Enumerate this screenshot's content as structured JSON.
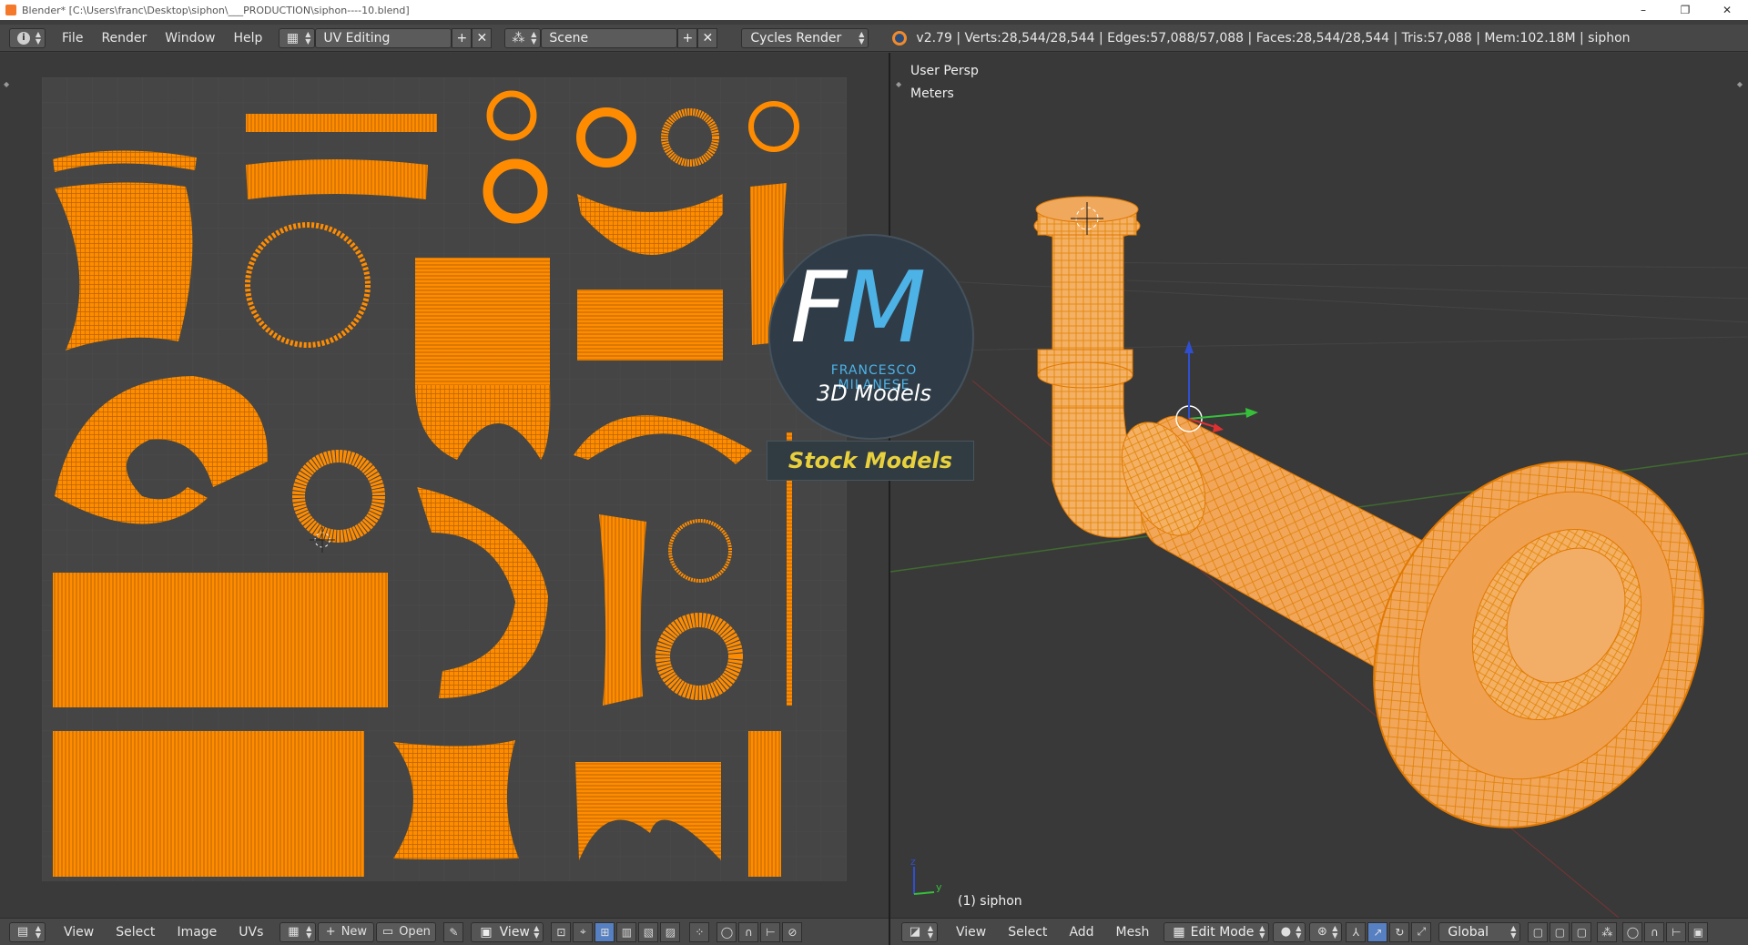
{
  "window": {
    "title": "Blender* [C:\\Users\\franc\\Desktop\\siphon\\___PRODUCTION\\siphon----10.blend]",
    "controls": [
      "–",
      "❐",
      "✕"
    ]
  },
  "info_header": {
    "menus": [
      "File",
      "Render",
      "Window",
      "Help"
    ],
    "screen_layout": "UV Editing",
    "scene": "Scene",
    "render_engine": "Cycles Render",
    "stats": "v2.79 | Verts:28,544/28,544 | Edges:57,088/57,088 | Faces:28,544/28,544 | Tris:57,088 | Mem:102.18M | siphon"
  },
  "uv_editor": {
    "menus": [
      "View",
      "Select",
      "Image",
      "UVs"
    ],
    "new_label": "New",
    "open_label": "Open",
    "view_label": "View",
    "uv_color": "#ff8c00",
    "grid_color": "#434343"
  },
  "viewport": {
    "view_name": "User Persp",
    "units": "Meters",
    "object_label": "(1) siphon",
    "menus": [
      "View",
      "Select",
      "Add",
      "Mesh"
    ],
    "mode": "Edit Mode",
    "orientation": "Global",
    "axis_z": "z",
    "axis_y": "y"
  },
  "watermark": {
    "letter_f": "F",
    "letter_m": "M",
    "name": "FRANCESCO MILANESE",
    "subtitle": "3D Models",
    "tag": "Stock Models"
  },
  "colors": {
    "accent_orange": "#ff8c00",
    "header_bg": "#474747",
    "active_blue": "#5680c2"
  }
}
